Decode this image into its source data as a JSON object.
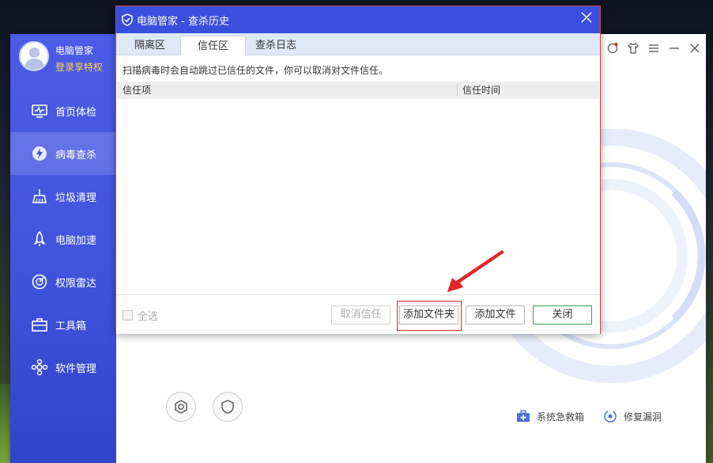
{
  "app": {
    "name": "电脑管家",
    "login_link": "登录享特权",
    "nav": [
      {
        "label": "首页体检",
        "icon": "monitor-icon"
      },
      {
        "label": "病毒查杀",
        "icon": "lightning-shield-icon",
        "active": true
      },
      {
        "label": "垃圾清理",
        "icon": "broom-icon"
      },
      {
        "label": "电脑加速",
        "icon": "rocket-icon"
      },
      {
        "label": "权限雷达",
        "icon": "radar-icon"
      },
      {
        "label": "工具箱",
        "icon": "toolbox-icon"
      },
      {
        "label": "软件管理",
        "icon": "software-icon"
      }
    ],
    "bottom_links": {
      "rescue_box": "系统急救箱",
      "repair": "修复漏洞"
    }
  },
  "dialog": {
    "title": "电脑管家 - 查杀历史",
    "tabs": [
      "隔离区",
      "信任区",
      "查杀日志"
    ],
    "active_tab": 1,
    "hint": "扫描病毒时会自动跳过已信任的文件，你可以取消对文件信任。",
    "columns": {
      "item": "信任项",
      "time": "信任时间"
    },
    "select_all": "全选",
    "buttons": {
      "cancel_trust": "取消信任",
      "add_folder": "添加文件夹",
      "add_file": "添加文件",
      "close": "关闭"
    }
  },
  "colors": {
    "accent_blue": "#3a4fdd",
    "highlight_red": "#e0262a",
    "close_green": "#3aa551",
    "login_yellow": "#ffd34d"
  }
}
